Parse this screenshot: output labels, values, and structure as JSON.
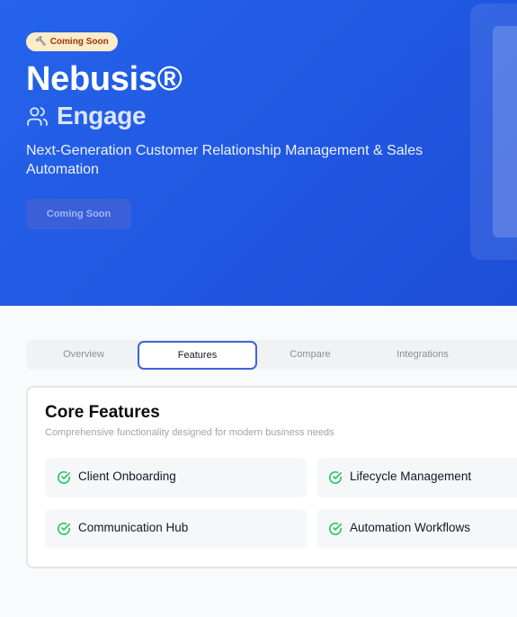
{
  "hero": {
    "badge_icon": "hammer-icon",
    "badge_label": "Coming Soon",
    "brand": "Nebusis®",
    "product_icon": "users-icon",
    "product_name": "Engage",
    "tagline": "Next-Generation Customer Relationship Management & Sales Automation",
    "cta_label": "Coming Soon",
    "background_color": "#2563eb"
  },
  "tabs": {
    "items": [
      {
        "label": "Overview",
        "active": false
      },
      {
        "label": "Features",
        "active": true
      },
      {
        "label": "Compare",
        "active": false
      },
      {
        "label": "Integrations",
        "active": false
      }
    ],
    "active_border_color": "#3f63d8"
  },
  "features": {
    "title": "Core Features",
    "subtitle": "Comprehensive functionality designed for modern business needs",
    "check_color": "#22c55e",
    "items": [
      {
        "label": "Client Onboarding",
        "icon": "check-circle-icon"
      },
      {
        "label": "Lifecycle Management",
        "icon": "check-circle-icon"
      },
      {
        "label": "Communication Hub",
        "icon": "check-circle-icon"
      },
      {
        "label": "Automation Workflows",
        "icon": "check-circle-icon"
      }
    ]
  }
}
